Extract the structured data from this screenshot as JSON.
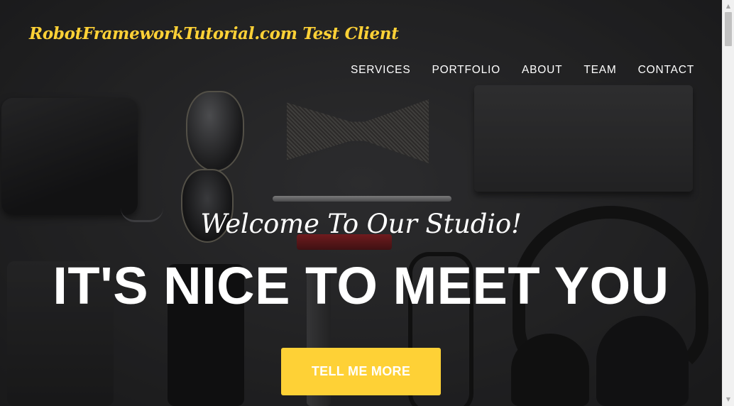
{
  "header": {
    "brand": "RobotFrameworkTutorial.com Test Client"
  },
  "nav": {
    "items": [
      {
        "label": "SERVICES"
      },
      {
        "label": "PORTFOLIO"
      },
      {
        "label": "ABOUT"
      },
      {
        "label": "TEAM"
      },
      {
        "label": "CONTACT"
      }
    ]
  },
  "hero": {
    "subheading": "Welcome To Our Studio!",
    "heading": "IT'S NICE TO MEET YOU",
    "cta_label": "TELL ME MORE"
  },
  "scrollbar": {
    "up_icon": "▲",
    "down_icon": "▼"
  },
  "colors": {
    "accent": "#fed136",
    "text": "#ffffff"
  }
}
